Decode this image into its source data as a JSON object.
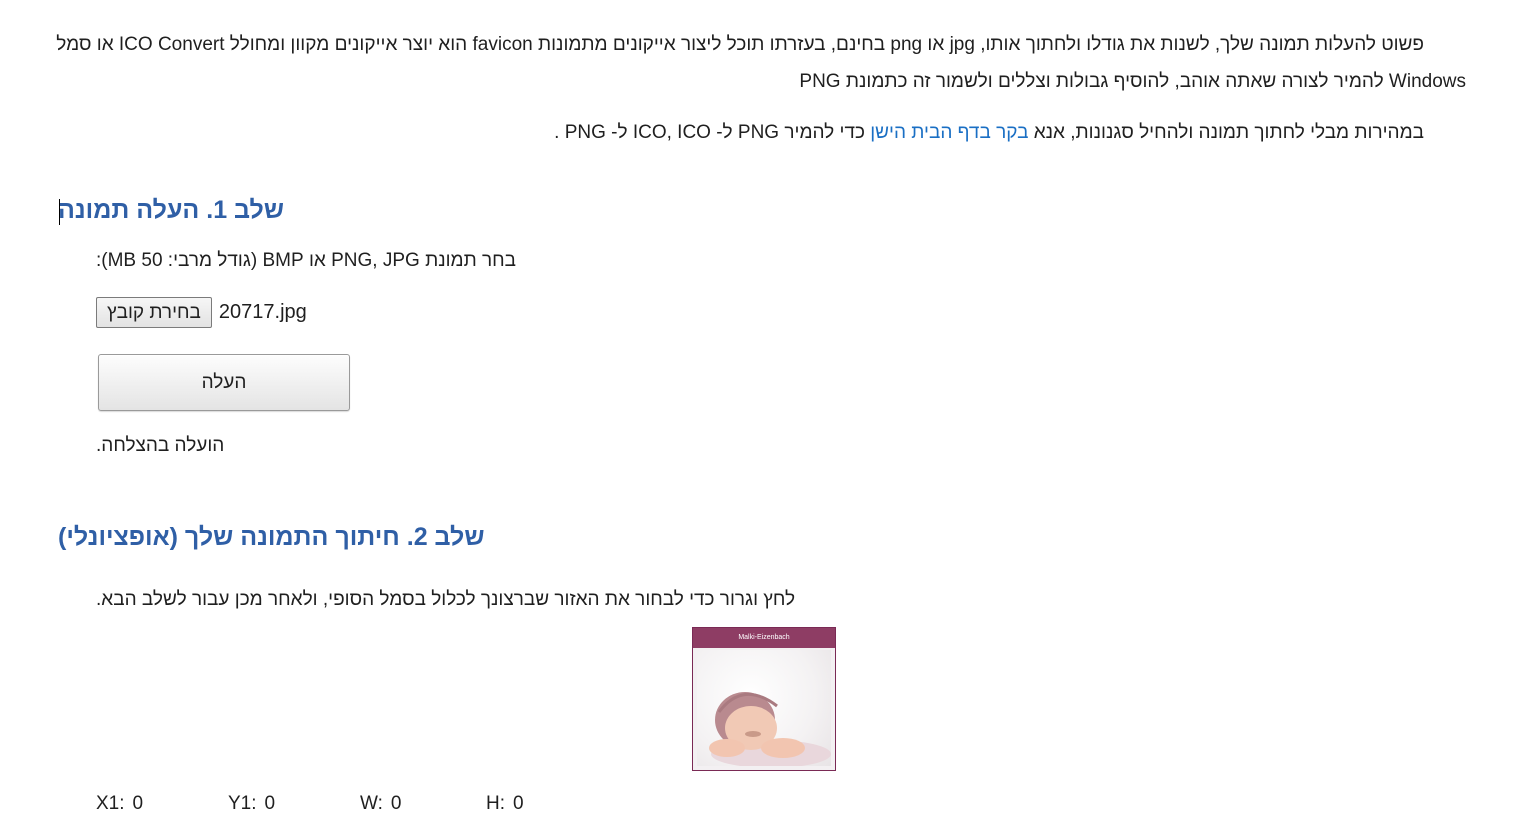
{
  "intro": {
    "paragraph1": "פשוט להעלות תמונה שלך, לשנות את גודלו ולחתוך אותו, jpg או png בחינם, בעזרתו תוכל ליצור אייקונים מתמונות favicon הוא יוצר אייקונים מקוון ומחולל ICO Convert או סמל Windows להמיר לצורה שאתה אוהב, להוסיף גבולות וצללים ולשמור זה כתמונת PNG",
    "paragraph2_before": "במהירות מבלי לחתוך תמונה ולהחיל סגנונות, אנא ",
    "paragraph2_link": "בקר בדף הבית הישן",
    "paragraph2_after": " כדי להמיר PNG ל- ICO, ICO ל- PNG ."
  },
  "step1": {
    "title": "שלב 1. העלה תמונה",
    "select_label": "בחר תמונת PNG, JPG או BMP (גודל מרבי: 50 MB):",
    "file_button_label": "בחירת קובץ",
    "file_name": "20717.jpg",
    "upload_button_label": "העלה",
    "status": "הועלה בהצלחה."
  },
  "step2": {
    "title": "שלב 2. חיתוך התמונה שלך (אופציונלי)",
    "instructions": "לחץ וגרור כדי לבחור את האזור שברצונך לכלול בסמל הסופי, ולאחר מכן עבור לשלב הבא.",
    "image_banner_text": "Malki-Eizenbach",
    "coords": {
      "x1_label": "X1:",
      "x1_value": "0",
      "y1_label": "Y1:",
      "y1_value": "0",
      "w_label": "W:",
      "w_value": "0",
      "h_label": "H:",
      "h_value": "0"
    }
  },
  "colors": {
    "heading": "#2f5fa6",
    "link": "#1a6fc4",
    "banner": "#8e3d64"
  }
}
